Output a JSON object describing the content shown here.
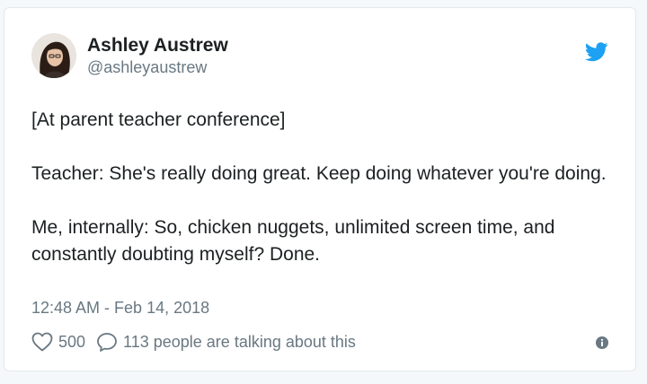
{
  "tweet": {
    "display_name": "Ashley Austrew",
    "handle": "@ashleyaustrew",
    "paragraphs": [
      "[At parent teacher conference]",
      "Teacher: She's really doing great. Keep doing whatever you're doing.",
      "Me, internally: So, chicken nuggets, unlimited screen time, and constantly doubting myself? Done."
    ],
    "timestamp": "12:48 AM - Feb 14, 2018",
    "like_count": "500",
    "reply_text": "113 people are talking about this"
  },
  "icons": {
    "brand": "twitter-bird-icon",
    "like": "heart-icon",
    "reply": "speech-bubble-icon",
    "info": "info-icon"
  },
  "colors": {
    "text": "#1c2022",
    "secondary": "#697882",
    "twitter_blue": "#1da1f2",
    "border": "#e1e8ed"
  }
}
